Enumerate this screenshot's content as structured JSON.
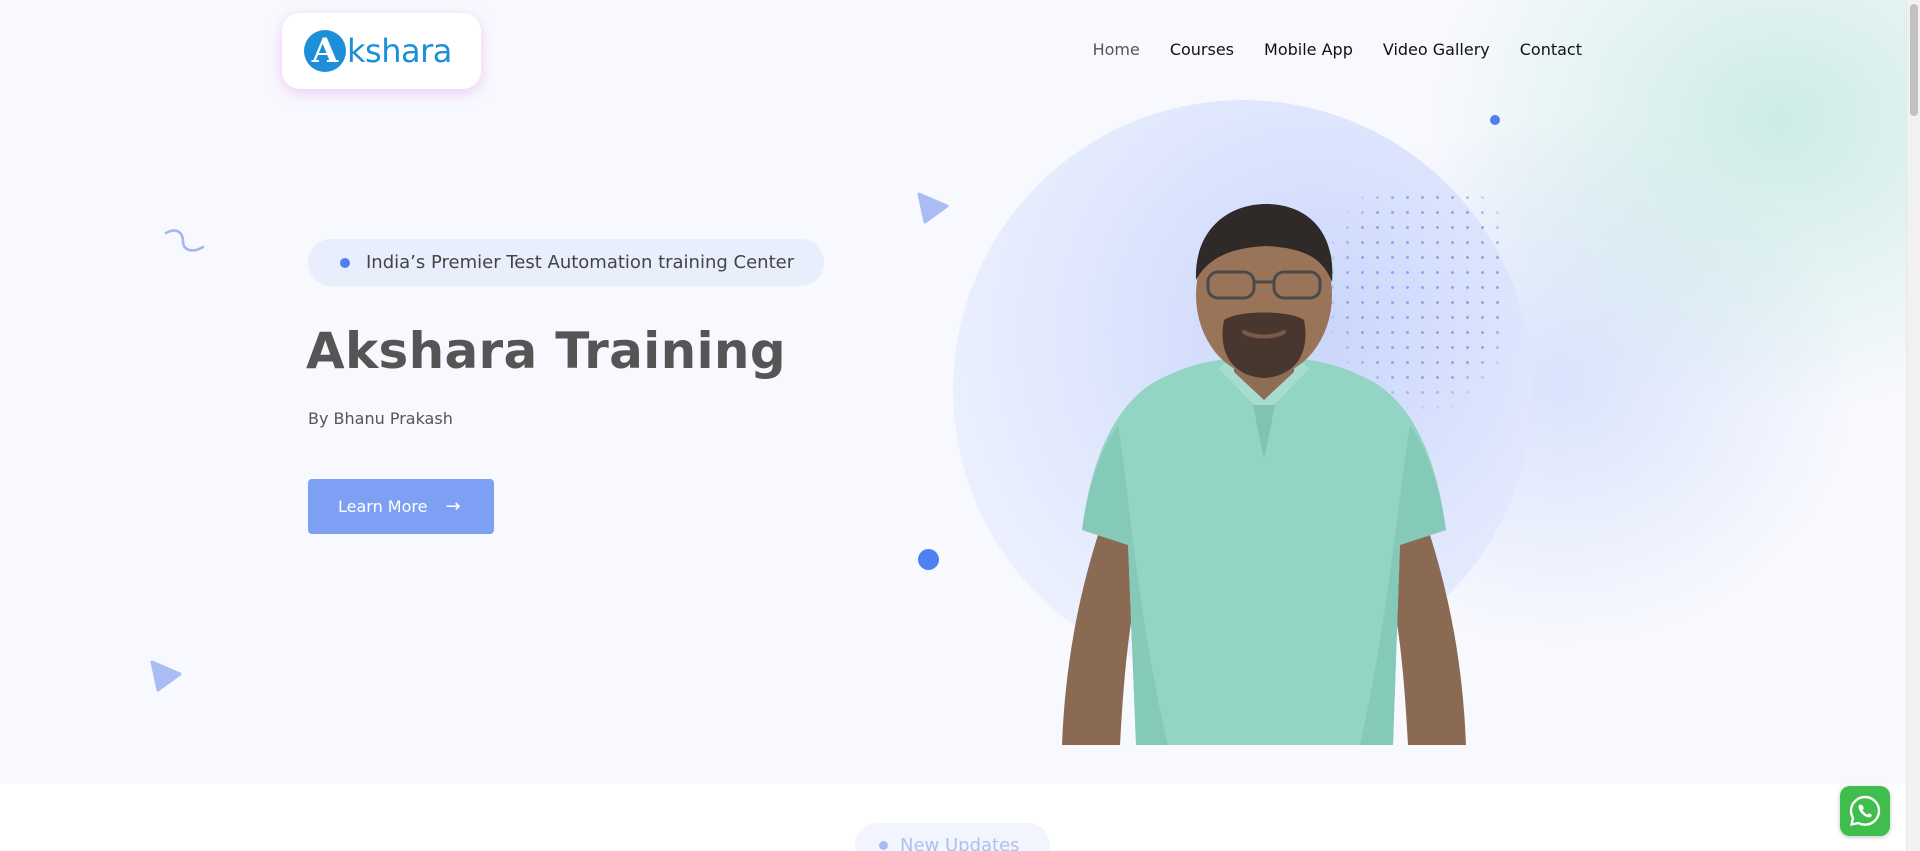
{
  "brand": {
    "mark": "A",
    "name": "kshara",
    "color": "#1d8fd8"
  },
  "nav": {
    "items": [
      {
        "label": "Home",
        "active": true
      },
      {
        "label": "Courses"
      },
      {
        "label": "Mobile App"
      },
      {
        "label": "Video Gallery"
      },
      {
        "label": "Contact"
      }
    ]
  },
  "hero": {
    "badge_text": "India’s Premier Test Automation training Center",
    "title": "Akshara Training",
    "subtitle": "By Bhanu Prakash",
    "cta_label": "Learn More",
    "cta_arrow": "→",
    "accent_color": "#4f7ff0"
  },
  "next_section": {
    "pill_label": "New Updates"
  },
  "icons": {
    "whatsapp": "whatsapp-icon",
    "decorations": [
      "squiggle-shape",
      "triangle-shape",
      "dot-shape"
    ]
  }
}
